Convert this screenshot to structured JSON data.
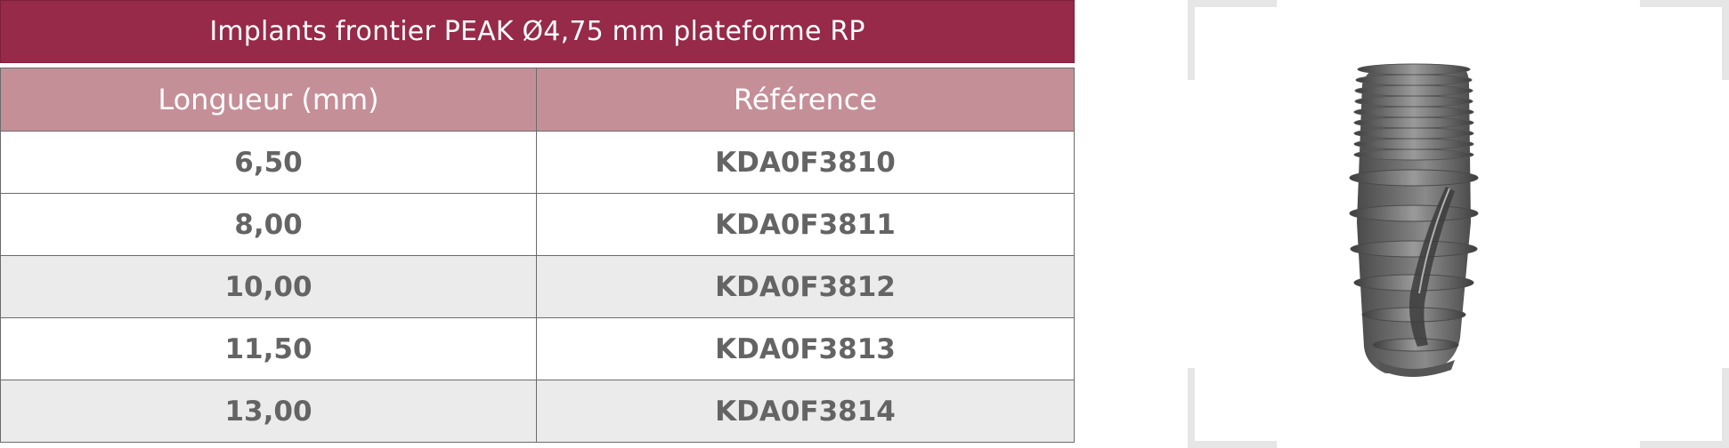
{
  "table": {
    "title": "Implants frontier PEAK Ø4,75 mm plateforme RP",
    "headers": [
      "Longueur (mm)",
      "Référence"
    ],
    "rows": [
      {
        "length": "6,50",
        "reference": "KDA0F3810"
      },
      {
        "length": "8,00",
        "reference": "KDA0F3811"
      },
      {
        "length": "10,00",
        "reference": "KDA0F3812"
      },
      {
        "length": "11,50",
        "reference": "KDA0F3813"
      },
      {
        "length": "13,00",
        "reference": "KDA0F3814"
      }
    ]
  },
  "colors": {
    "title_bg": "#962a48",
    "header_bg": "#c58f98",
    "row_shade": "#ebebeb",
    "value_text": "#646464"
  },
  "product_image": {
    "icon": "dental-implant-image"
  }
}
